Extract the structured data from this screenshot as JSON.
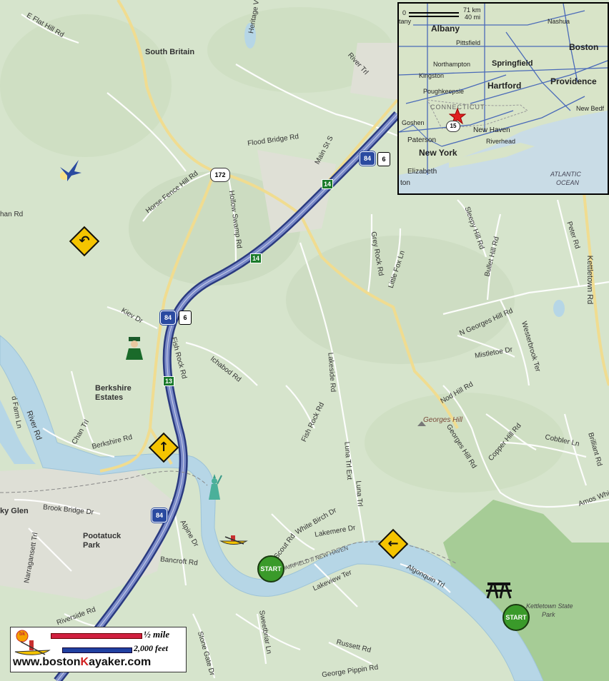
{
  "towns": {
    "south_britain": "South Britain",
    "berkshire_estates_1": "Berkshire",
    "berkshire_estates_2": "Estates",
    "pootatuck_1": "Pootatuck",
    "pootatuck_2": "Park",
    "sky_glen": "ky Glen"
  },
  "roads": {
    "e_flat_hill": "E Flat Hill Rd",
    "heritage": "Heritage V",
    "flood_bridge": "Flood Bridge Rd",
    "main_st_s": "Main St S",
    "horse_fence": "Horse Fence Hill Rd",
    "hollow_swamp": "Hollow Swamp Rd",
    "river_trl": "River Trl",
    "kiev": "Kiev Dr",
    "fish_rock_1": "Fish Rock Rd",
    "fish_rock_2": "Fish Rock Rd",
    "ichabod": "Ichabod Rd",
    "lakeside": "Lakeside Rd",
    "grey_rock": "Grey Rock Rd",
    "little_fox": "Little Fox Ln",
    "sleepy_hill": "Sleepy Hill Rd",
    "bullet_hill": "Bullet Hill Rd",
    "peter": "Peter Rd",
    "kettletown": "Kettletown Rd",
    "n_georges_hill": "N Georges Hill Rd",
    "westerbrook": "Westerbrook Ter",
    "mistletoe": "Mistletoe Dr",
    "nod_hill": "Nod Hill Rd",
    "georges_hill_rd": "Georges Hill Rd",
    "copper_hill": "Copper Hill Rd",
    "cobbler": "Cobbler Ln",
    "brilliant": "Brilliant Rd",
    "amos_white": "Amos White",
    "river_rd": "River Rd",
    "chan_trl": "Chan Trl",
    "berkshire_rd": "Berkshire Rd",
    "brook_bridge": "Brook Bridge Dr",
    "narragansett": "Narragansett Trl",
    "alpine": "Alpine Dr",
    "bancroft": "Bancroft Rd",
    "scout": "Scout Rd",
    "white_birch": "White Birch Dr",
    "lakemere": "Lakemere Dr",
    "luna_trl_ext": "Luna Trl Ext",
    "luna_trl": "Luna Trl",
    "lakeview": "Lakeview Ter",
    "algonquin": "Algonquin Trl",
    "riverside": "Riverside Rd",
    "sweetbriar": "Sweetbriar Ln",
    "russett": "Russett Rd",
    "stone_gate": "Stone Gate Dr",
    "george_pippin": "George Pippin Rd",
    "farm_ln": "d Farm Ln",
    "han_rd": "han Rd"
  },
  "places": {
    "georges_hill": "Georges Hill",
    "fairfield_newhaven": "FAIRFIELD // NEW HAVEN",
    "kettletown_park_1": "Kettletown State",
    "kettletown_park_2": "Park"
  },
  "shields": {
    "i84_top": "84",
    "us6_top": "6",
    "ct172": "172",
    "i84_mid": "84",
    "us6_mid": "6",
    "i84_bot": "84"
  },
  "exits": {
    "e14_top": "14",
    "e14_mid": "14",
    "e13": "13"
  },
  "start_markers": {
    "start1": "START",
    "start2": "START"
  },
  "inset": {
    "scale_km": "71 km",
    "scale_mi": "40 mi",
    "scale_zero": "0",
    "albany": "Albany",
    "nashua": "Nashua",
    "pittsfield": "Pittsfield",
    "boston": "Boston",
    "northampton": "Northampton",
    "springfield": "Springfield",
    "kingston": "Kingston",
    "hartford": "Hartford",
    "providence": "Providence",
    "poughkeepsie": "Poughkeepsie",
    "connecticut": "CONNECTICUT",
    "new_bedford": "New Bedf",
    "goshen": "Goshen",
    "new_haven": "New Haven",
    "paterson": "Paterson",
    "riverhead": "Riverhead",
    "new_york": "New York",
    "elizabeth": "Elizabeth",
    "ton": "ton",
    "atlantic": "ATLANTIC",
    "ocean": "OCEAN",
    "route15": "15",
    "top_label": "tany"
  },
  "scale": {
    "half_mile": "½ mile",
    "feet": "2,000 feet",
    "site_pre": "www.boston",
    "site_k": "K",
    "site_post": "ayaker.com",
    "logo": "bk"
  },
  "colors": {
    "water": "#b6d6e6",
    "land": "#d6e4cc",
    "forest": "#a6cc96",
    "interstate": "#5a6ab0",
    "road_yellow": "#f0dc90",
    "sign_yellow": "#f5c400",
    "start_green": "#3a9a2a"
  },
  "icons": [
    "bird-icon",
    "uturn-sign-icon",
    "soldier-icon",
    "straight-arrow-sign-icon",
    "statue-of-liberty-icon",
    "kayak-icon",
    "left-arrow-sign-icon",
    "picnic-table-icon",
    "start-marker-icon"
  ]
}
